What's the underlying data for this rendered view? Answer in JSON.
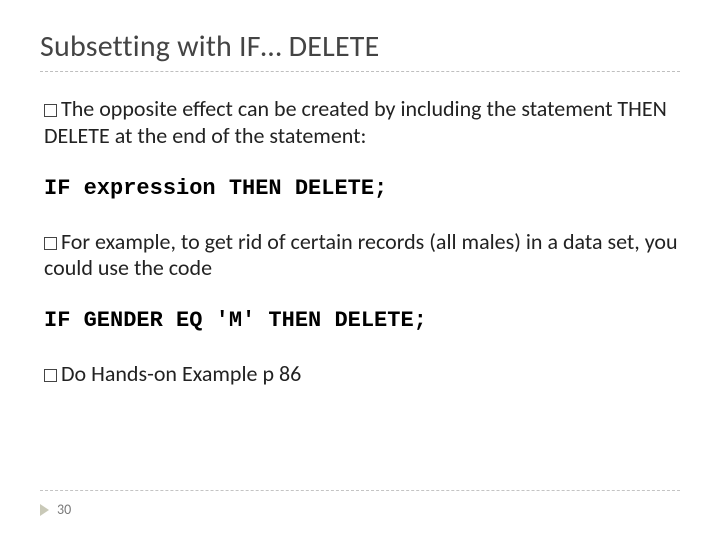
{
  "title": "Subsetting with IF… DELETE",
  "para1": "The opposite effect can be created by including the statement THEN DELETE at the end of the statement:",
  "code1": "IF expression THEN DELETE;",
  "para2": "For example, to get rid of certain records (all males) in a data set, you could use the code",
  "code2": "IF GENDER EQ 'M' THEN DELETE;",
  "para3": "Do Hands-on Example p 86",
  "page_number": "30"
}
